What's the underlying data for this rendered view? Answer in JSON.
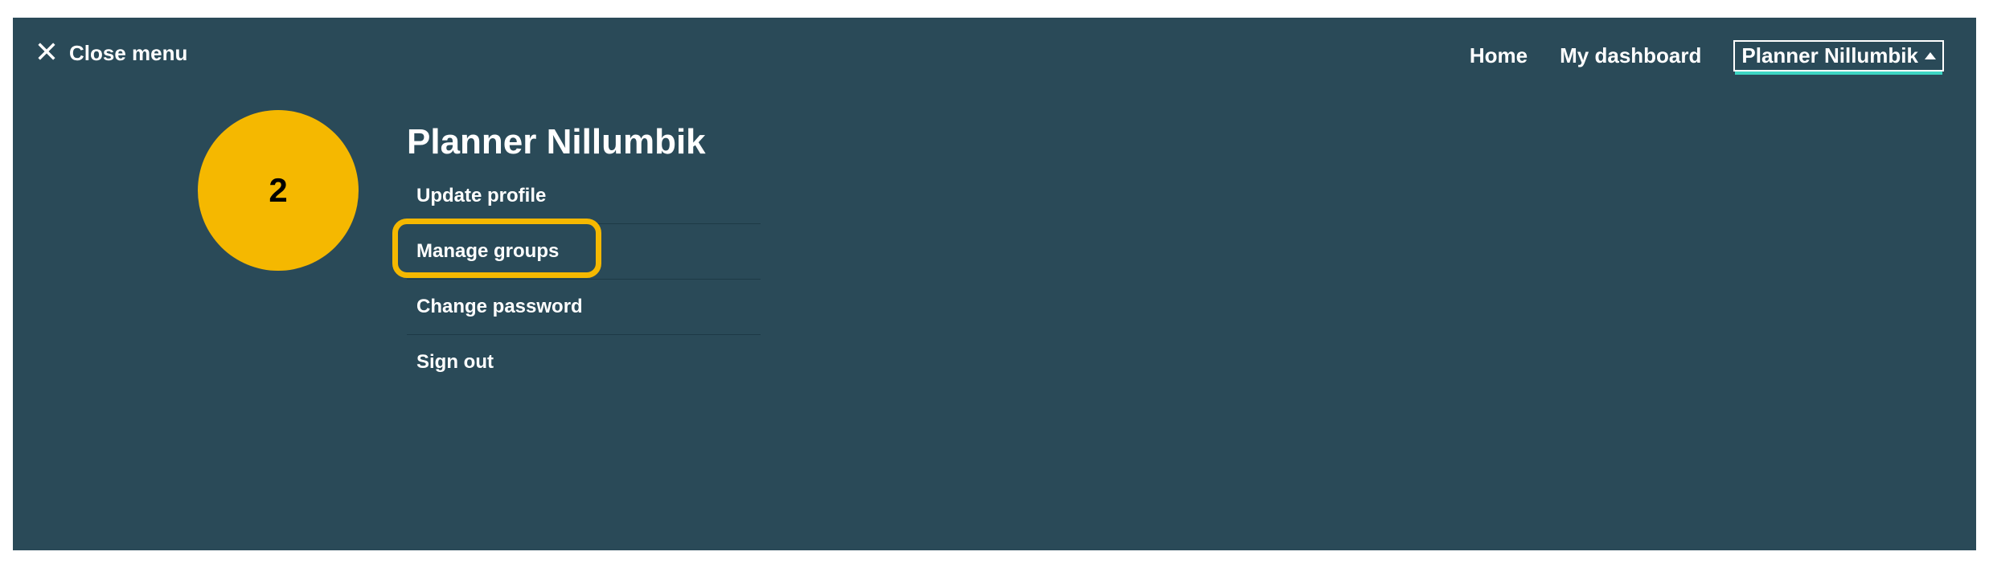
{
  "close_menu": {
    "label": "Close menu"
  },
  "nav": {
    "home": "Home",
    "dashboard": "My dashboard",
    "dropdown_label": "Planner Nillumbik"
  },
  "badge": {
    "number": "2"
  },
  "section": {
    "title": "Planner Nillumbik",
    "items": {
      "update_profile": "Update profile",
      "manage_groups": "Manage groups",
      "change_password": "Change password",
      "sign_out": "Sign out"
    }
  },
  "colors": {
    "panel_bg": "#2a4a58",
    "accent_yellow": "#f5b800",
    "accent_teal": "#3dd6c4"
  }
}
